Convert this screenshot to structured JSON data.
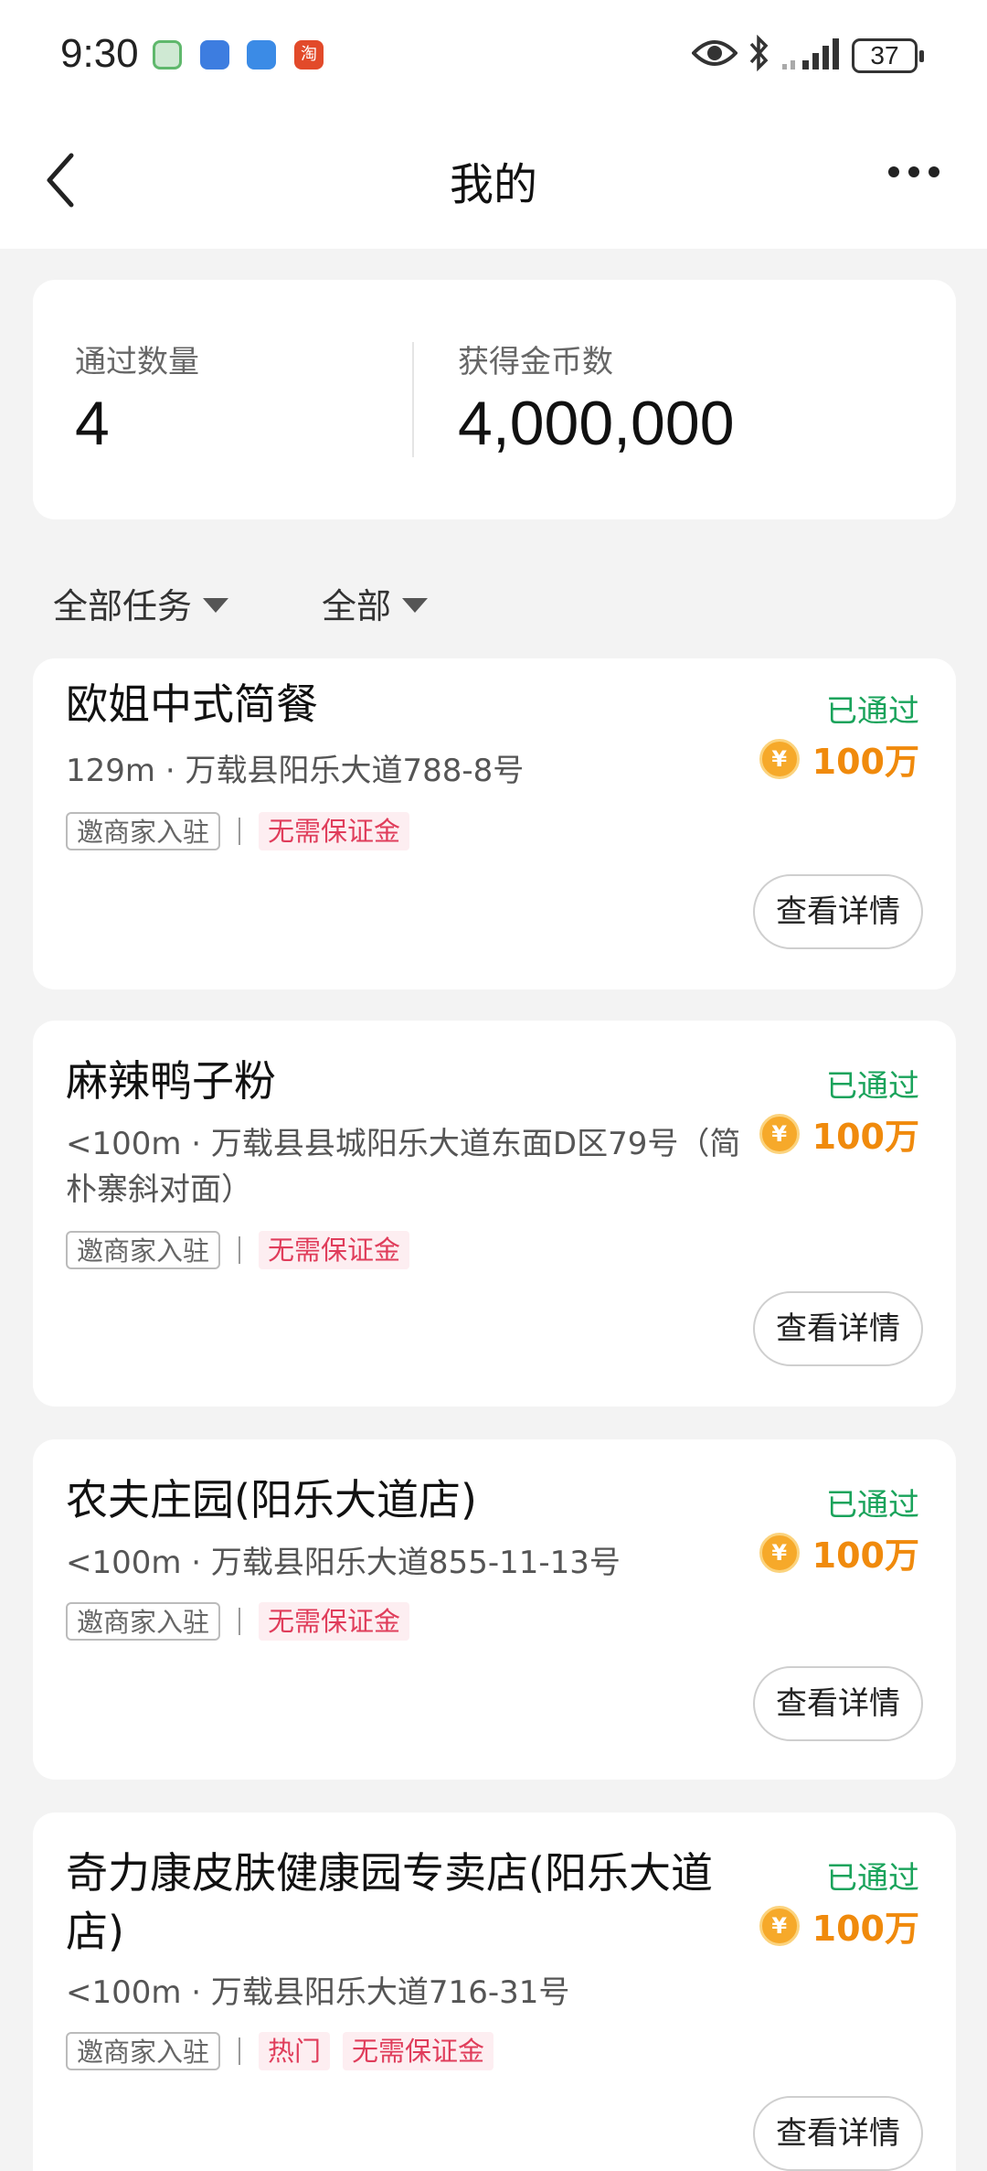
{
  "status_bar": {
    "time": "9:30",
    "battery": "37",
    "app4_glyph": "淘"
  },
  "nav": {
    "title": "我的"
  },
  "summary": {
    "passed_label": "通过数量",
    "passed_value": "4",
    "coins_label": "获得金币数",
    "coins_value": "4,000,000"
  },
  "filters": {
    "task": "全部任务",
    "status": "全部"
  },
  "coin_symbol": "¥",
  "tasks": [
    {
      "title": "欧姐中式简餐",
      "address": "129m · 万载县阳乐大道788-8号",
      "tags": [
        "邀商家入驻",
        "无需保证金"
      ],
      "status": "已通过",
      "reward": "100万",
      "button": "查看详情"
    },
    {
      "title": "麻辣鸭子粉",
      "address": "<100m · 万载县县城阳乐大道东面D区79号（简朴寨斜对面）",
      "tags": [
        "邀商家入驻",
        "无需保证金"
      ],
      "status": "已通过",
      "reward": "100万",
      "button": "查看详情"
    },
    {
      "title": "农夫庄园(阳乐大道店)",
      "address": "<100m · 万载县阳乐大道855-11-13号",
      "tags": [
        "邀商家入驻",
        "无需保证金"
      ],
      "status": "已通过",
      "reward": "100万",
      "button": "查看详情"
    },
    {
      "title": "奇力康皮肤健康园专卖店(阳乐大道店)",
      "address": "<100m · 万载县阳乐大道716-31号",
      "tags": [
        "邀商家入驻",
        "热门",
        "无需保证金"
      ],
      "status": "已通过",
      "reward": "100万",
      "button": "查看详情"
    }
  ],
  "colors": {
    "status_green": "#1aa35b",
    "reward_orange": "#f08a0c",
    "tag_pink": "#e03d5b"
  }
}
